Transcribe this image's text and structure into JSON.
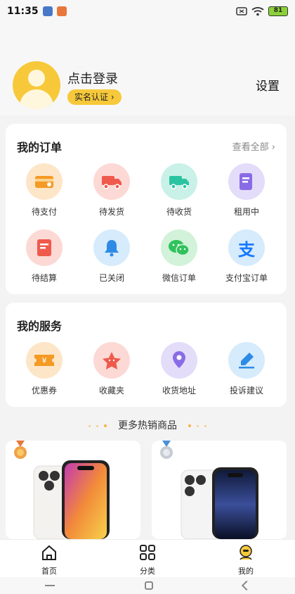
{
  "status": {
    "time": "11:35",
    "battery": "81"
  },
  "profile": {
    "login_text": "点击登录",
    "verify_label": "实名认证",
    "settings_label": "设置"
  },
  "orders": {
    "title": "我的订单",
    "view_all": "查看全部",
    "items": [
      {
        "label": "待支付",
        "icon": "wallet-icon",
        "color": "#fde6c8"
      },
      {
        "label": "待发货",
        "icon": "truck-icon",
        "color": "#fcd9d5"
      },
      {
        "label": "待收货",
        "icon": "delivery-truck-icon",
        "color": "#c9f1e7"
      },
      {
        "label": "租用中",
        "icon": "document-icon",
        "color": "#e3ddfa"
      },
      {
        "label": "待结算",
        "icon": "bill-icon",
        "color": "#fcd9d5"
      },
      {
        "label": "已关闭",
        "icon": "bell-icon",
        "color": "#d6ebfb"
      },
      {
        "label": "微信订单",
        "icon": "wechat-icon",
        "color": "#d2f2d9"
      },
      {
        "label": "支付宝订单",
        "icon": "alipay-icon",
        "color": "#d6ebfb"
      }
    ]
  },
  "services": {
    "title": "我的服务",
    "items": [
      {
        "label": "优惠券",
        "icon": "coupon-icon",
        "color": "#fde6c8"
      },
      {
        "label": "收藏夹",
        "icon": "star-icon",
        "color": "#fcd9d5"
      },
      {
        "label": "收货地址",
        "icon": "location-icon",
        "color": "#e3ddfa"
      },
      {
        "label": "投诉建议",
        "icon": "edit-icon",
        "color": "#d6ebfb"
      }
    ]
  },
  "hot": {
    "title": "更多热销商品"
  },
  "tabs": [
    {
      "label": "首页",
      "icon": "home-icon"
    },
    {
      "label": "分类",
      "icon": "category-icon"
    },
    {
      "label": "我的",
      "icon": "profile-icon"
    }
  ]
}
